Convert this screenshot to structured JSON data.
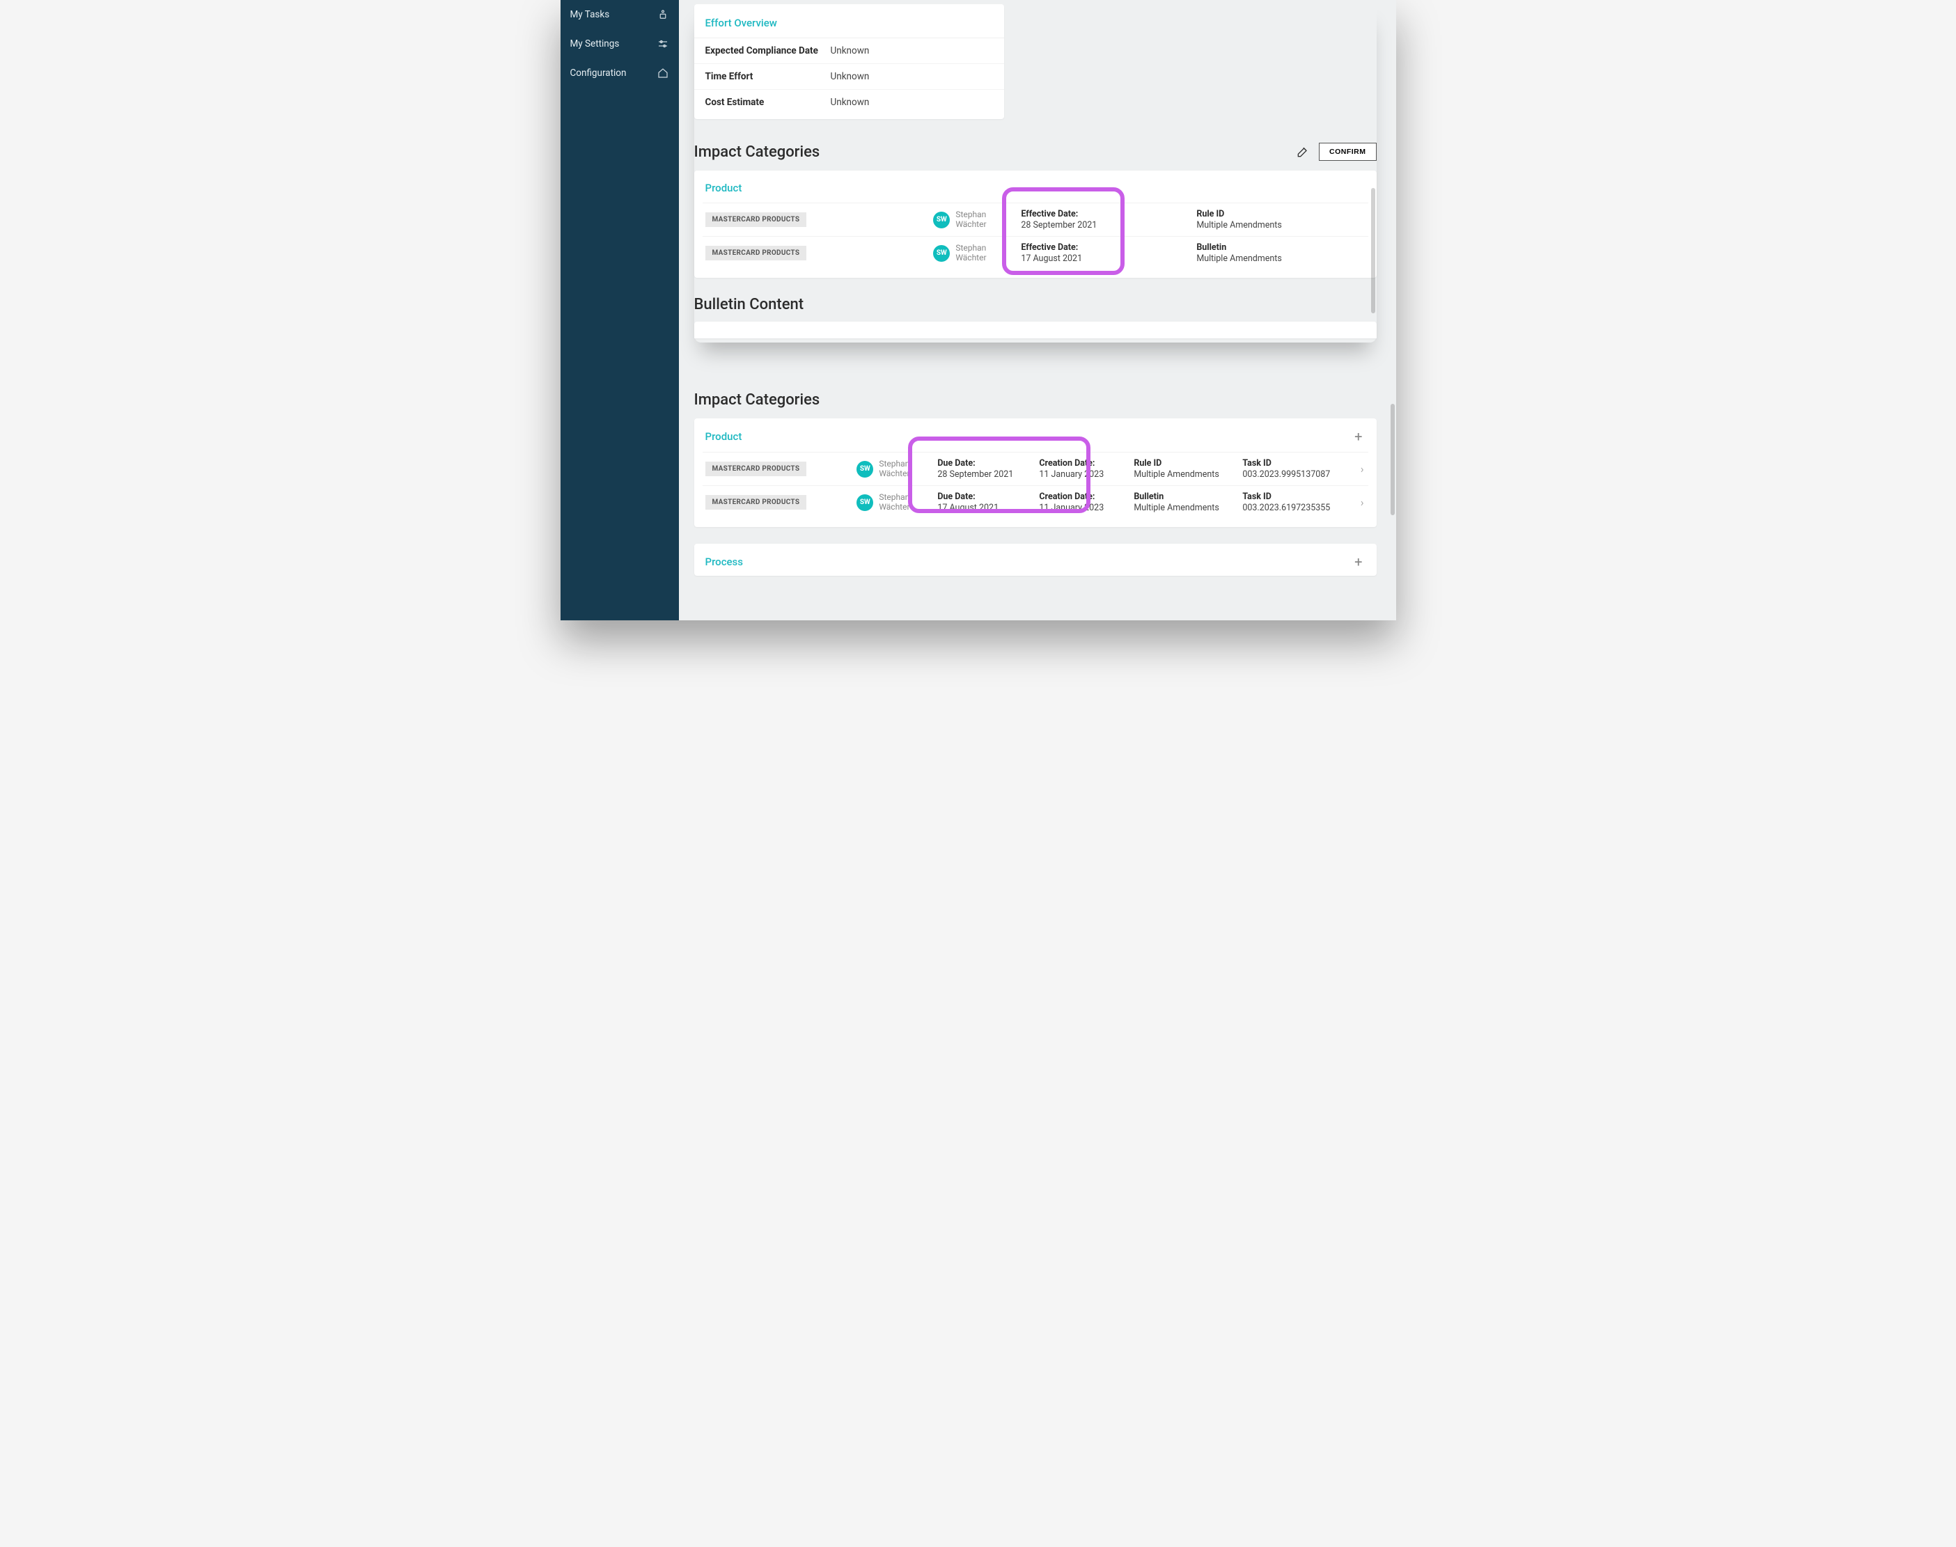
{
  "sidebar": {
    "items": [
      {
        "label": "My Tasks",
        "icon": "user-tasks-icon"
      },
      {
        "label": "My Settings",
        "icon": "sliders-icon"
      },
      {
        "label": "Configuration",
        "icon": "home-icon"
      }
    ]
  },
  "effort": {
    "title": "Effort Overview",
    "rows": [
      {
        "label": "Expected Compliance Date",
        "value": "Unknown"
      },
      {
        "label": "Time Effort",
        "value": "Unknown"
      },
      {
        "label": "Cost Estimate",
        "value": "Unknown"
      }
    ]
  },
  "section1": {
    "title": "Impact Categories",
    "confirm_label": "CONFIRM",
    "panel_title": "Product",
    "rows": [
      {
        "tag": "MASTERCARD PRODUCTS",
        "user_initials": "SW",
        "user_first": "Stephan",
        "user_last": "Wächter",
        "col_a_label": "Effective Date:",
        "col_a_value": "28 September 2021",
        "col_b_label": "Rule ID",
        "col_b_value": "Multiple Amendments"
      },
      {
        "tag": "MASTERCARD PRODUCTS",
        "user_initials": "SW",
        "user_first": "Stephan",
        "user_last": "Wächter",
        "col_a_label": "Effective Date:",
        "col_a_value": "17 August 2021",
        "col_b_label": "Bulletin",
        "col_b_value": "Multiple Amendments"
      }
    ]
  },
  "bulletin_title": "Bulletin Content",
  "section2": {
    "title": "Impact Categories",
    "panel_title": "Product",
    "panel2_title": "Process",
    "rows": [
      {
        "tag": "MASTERCARD PRODUCTS",
        "user_initials": "SW",
        "user_first": "Stephan",
        "user_last": "Wächter",
        "due_label": "Due Date:",
        "due_value": "28 September 2021",
        "create_label": "Creation Date:",
        "create_value": "11 January 2023",
        "rule_label": "Rule ID",
        "rule_value": "Multiple Amendments",
        "task_label": "Task ID",
        "task_value": "003.2023.9995137087"
      },
      {
        "tag": "MASTERCARD PRODUCTS",
        "user_initials": "SW",
        "user_first": "Stephan",
        "user_last": "Wächter",
        "due_label": "Due Date:",
        "due_value": "17 August 2021",
        "create_label": "Creation Date:",
        "create_value": "11 January 2023",
        "rule_label": "Bulletin",
        "rule_value": "Multiple Amendments",
        "task_label": "Task ID",
        "task_value": "003.2023.6197235355"
      }
    ]
  }
}
